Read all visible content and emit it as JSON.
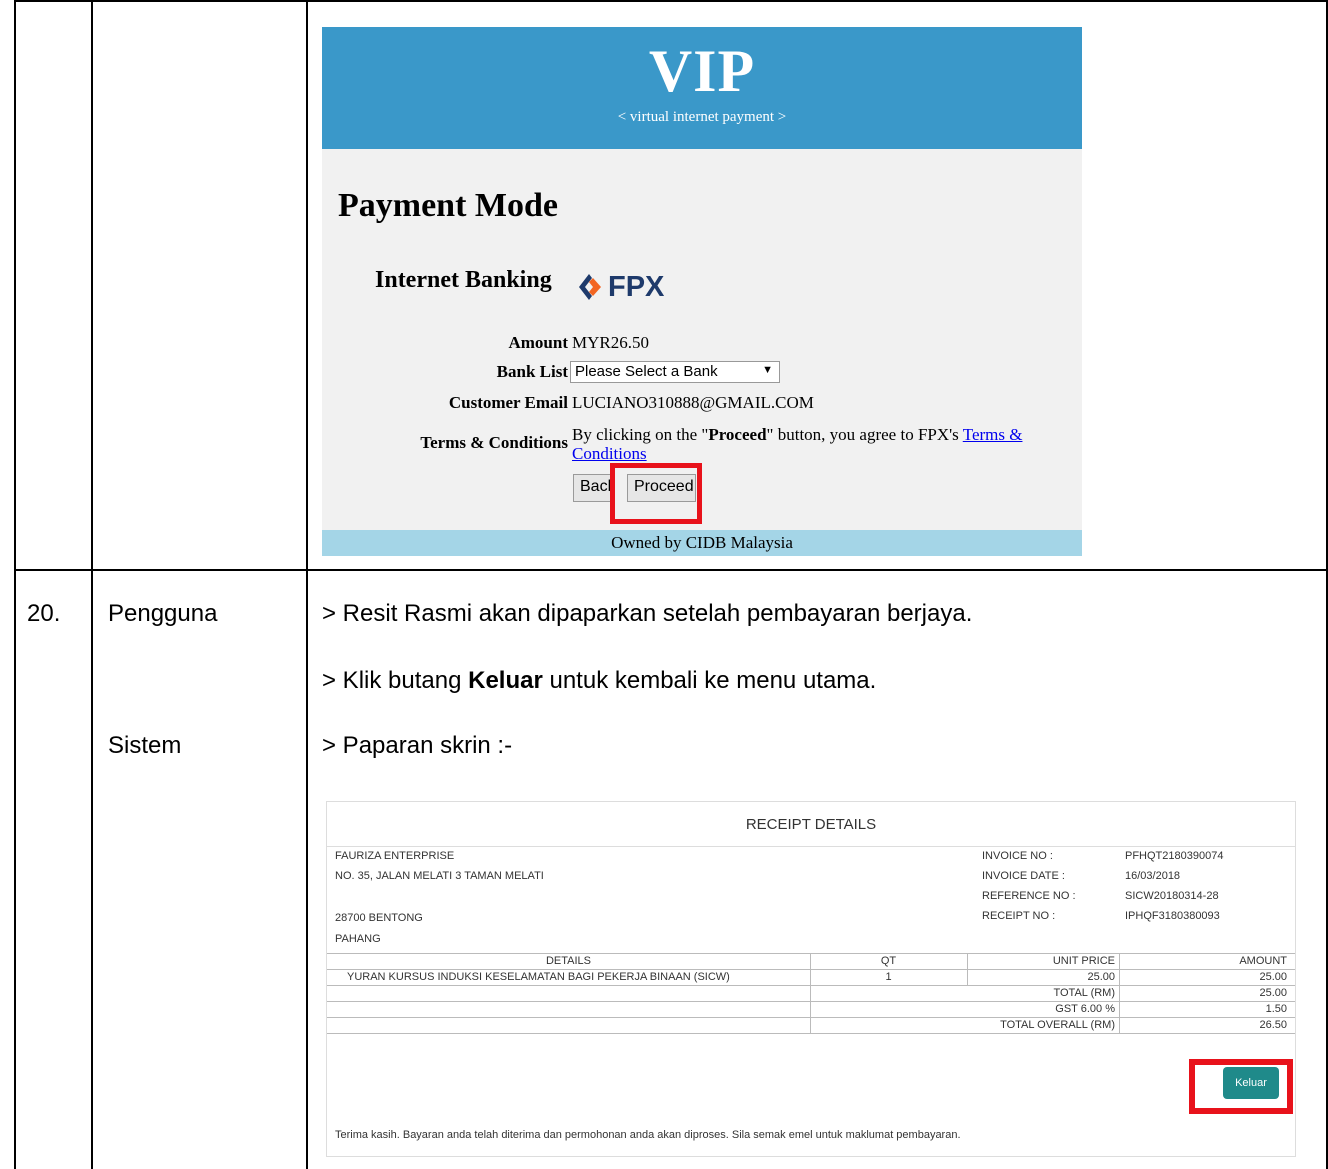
{
  "vip": {
    "logo": "VIP",
    "tagline": "< virtual internet payment >",
    "heading": "Payment Mode",
    "internet_banking": "Internet Banking",
    "fpx_logo": "FPX",
    "amount_label": "Amount",
    "amount_value": "MYR26.50",
    "bank_list_label": "Bank List",
    "bank_list_selected": "Please Select a Bank",
    "customer_email_label": "Customer Email",
    "customer_email_value": "LUCIANO310888@GMAIL.COM",
    "terms_label": "Terms & Conditions",
    "terms_text_before": "By clicking on the \"",
    "terms_text_bold": "Proceed",
    "terms_text_after": "\" button, you agree to FPX's ",
    "terms_link": "Terms & Conditions",
    "back_button": "Back",
    "proceed_button": "Proceed",
    "footer": "Owned by CIDB Malaysia"
  },
  "step": {
    "number": "20.",
    "actor_user": "Pengguna",
    "actor_system": "Sistem",
    "line1": "> Resit Rasmi akan dipaparkan setelah pembayaran berjaya.",
    "line2_before": "> Klik butang ",
    "line2_bold": "Keluar",
    "line2_after": " untuk kembali ke menu utama.",
    "line3": "> Paparan skrin :-"
  },
  "receipt": {
    "title": "RECEIPT DETAILS",
    "company": "FAURIZA ENTERPRISE",
    "address1": "NO. 35, JALAN MELATI 3 TAMAN MELATI",
    "address2": "28700 BENTONG",
    "address3": "PAHANG",
    "invoice_no_label": "INVOICE NO :",
    "invoice_no": "PFHQT2180390074",
    "invoice_date_label": "INVOICE DATE :",
    "invoice_date": "16/03/2018",
    "reference_no_label": "REFERENCE NO :",
    "reference_no": "SICW20180314-28",
    "receipt_no_label": "RECEIPT NO :",
    "receipt_no": "IPHQF3180380093",
    "headers": {
      "details": "DETAILS",
      "qt": "QT",
      "unit_price": "UNIT PRICE",
      "amount": "AMOUNT"
    },
    "item": {
      "details": "YURAN KURSUS INDUKSI KESELAMATAN BAGI PEKERJA BINAAN (SICW)",
      "qt": "1",
      "unit_price": "25.00",
      "amount": "25.00"
    },
    "total_label": "TOTAL (RM)",
    "total": "25.00",
    "gst_label": "GST 6.00 %",
    "gst": "1.50",
    "overall_label": "TOTAL OVERALL (RM)",
    "overall": "26.50",
    "keluar_button": "Keluar",
    "thanks": "Terima kasih. Bayaran anda telah diterima dan permohonan anda akan diproses. Sila semak emel untuk maklumat pembayaran."
  }
}
